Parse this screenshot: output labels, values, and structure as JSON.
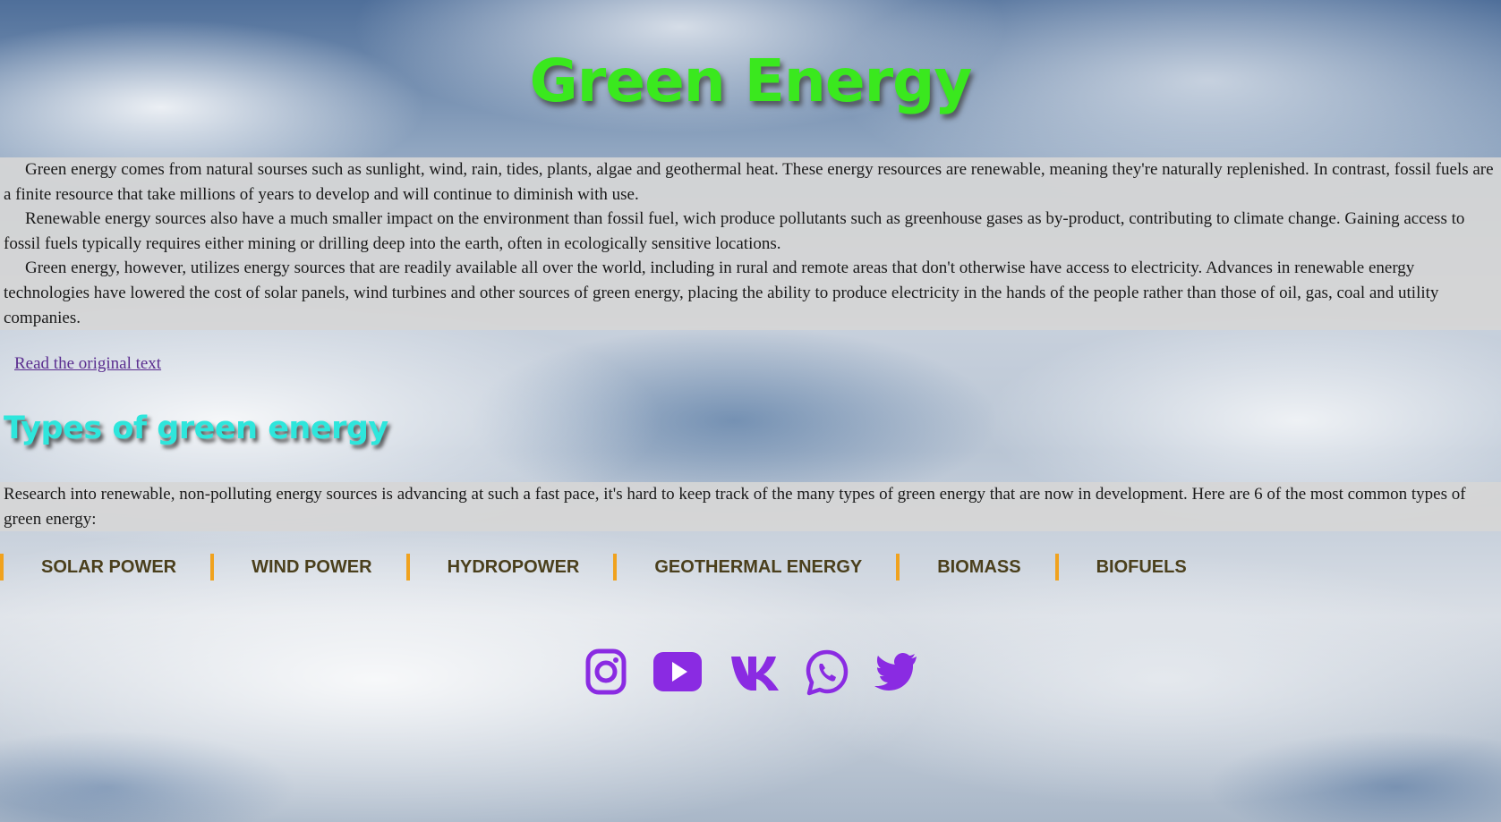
{
  "header": {
    "title": "Green Energy"
  },
  "intro": {
    "paragraphs": [
      "Green energy comes from natural sourses such as sunlight, wind, rain, tides, plants, algae and geothermal heat. These energy resources are renewable, meaning they're naturally replenished. In contrast, fossil fuels are a finite resource that take millions of years to develop and will continue to diminish with use.",
      "Renewable energy sources also have a much smaller impact on the environment than fossil fuel, wich produce pollutants such as greenhouse gases as by-product, contributing to climate change. Gaining access to fossil fuels typically requires either mining or drilling deep into the earth, often in ecologically sensitive locations.",
      "Green energy, however, utilizes energy sources that are readily available all over the world, including in rural and remote areas that don't otherwise have access to electricity. Advances in renewable energy technologies have lowered the cost of solar panels, wind turbines and other sources of green energy, placing the ability to produce electricity in the hands of the people rather than those of oil, gas, coal and utility companies."
    ]
  },
  "link": {
    "label": "Read the original text"
  },
  "types": {
    "heading": "Types of green energy",
    "description": "Research into renewable, non-polluting energy sources is advancing at such a fast pace, it's hard to keep track of the many types of green energy that are now in development. Here are 6 of the most common types of green energy:",
    "items": [
      "SOLAR POWER",
      "WIND POWER",
      "HYDROPOWER",
      "GEOTHERMAL ENERGY",
      "BIOMASS",
      "BIOFUELS"
    ]
  },
  "socials": {
    "icons": [
      "instagram-icon",
      "youtube-icon",
      "vk-icon",
      "whatsapp-icon",
      "twitter-icon"
    ],
    "color": "#8a2be2"
  },
  "colors": {
    "title": "#3ae81e",
    "heading": "#2ee6dc",
    "separator": "#f0a21e",
    "nav_text": "#4a3f1c",
    "link": "#5a2d8f",
    "text_panel": "#d6d6d6"
  }
}
